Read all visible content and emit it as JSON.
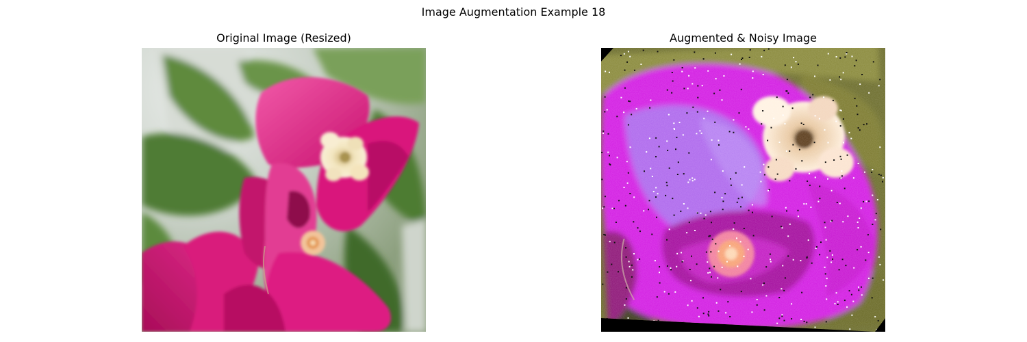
{
  "figure": {
    "title": "Image Augmentation Example 18"
  },
  "panels": [
    {
      "title": "Original Image (Resized)",
      "content": "photo-bougainvillea-flower"
    },
    {
      "title": "Augmented & Noisy Image",
      "content": "photo-bougainvillea-flower-rotated-noisy"
    }
  ],
  "colors": {
    "magenta": "#d4137a",
    "pink_light": "#f05aa6",
    "leaf_green": "#5f8a3c",
    "augmented_magenta": "#d21ee6",
    "augmented_violet": "#a86ef0",
    "cream": "#f6e8c8"
  }
}
